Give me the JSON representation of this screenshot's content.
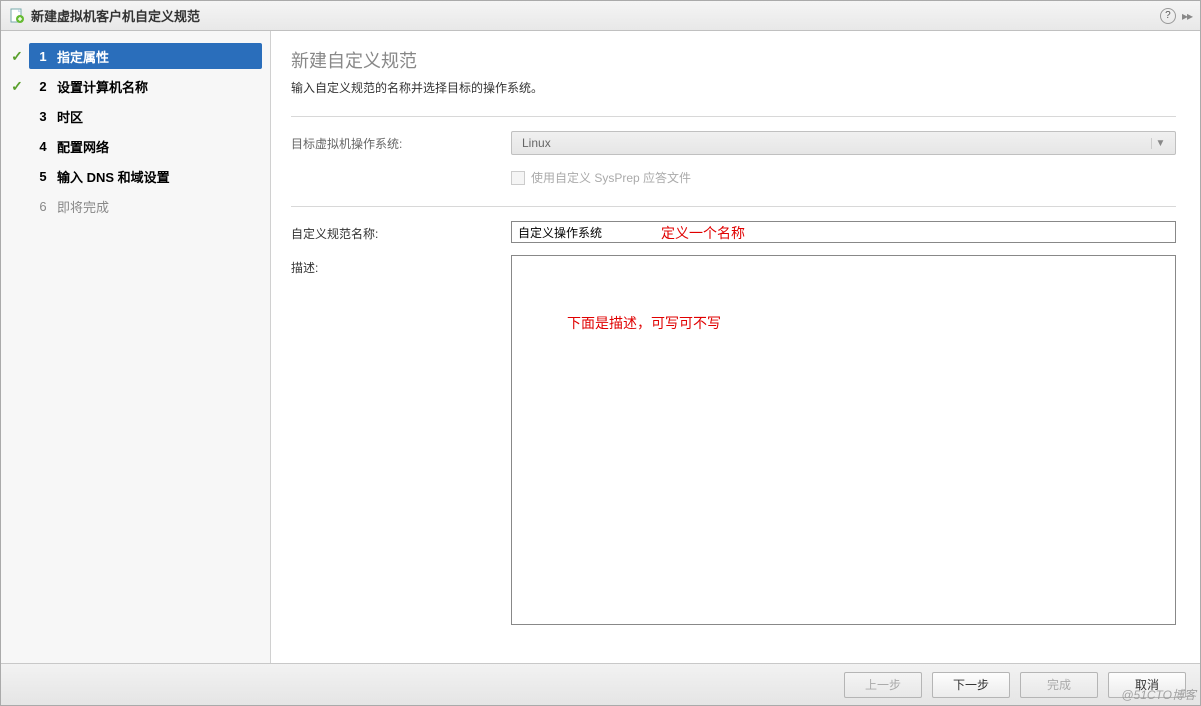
{
  "titlebar": {
    "title": "新建虚拟机客户机自定义规范"
  },
  "sidebar": {
    "steps": [
      {
        "num": "1",
        "label": "指定属性",
        "checked": true,
        "active": true
      },
      {
        "num": "2",
        "label": "设置计算机名称",
        "checked": true,
        "active": false
      },
      {
        "num": "3",
        "label": "时区",
        "checked": false,
        "active": false
      },
      {
        "num": "4",
        "label": "配置网络",
        "checked": false,
        "active": false
      },
      {
        "num": "5",
        "label": "输入 DNS 和域设置",
        "checked": false,
        "active": false
      },
      {
        "num": "6",
        "label": "即将完成",
        "checked": false,
        "active": false,
        "dim": true
      }
    ]
  },
  "main": {
    "title": "新建自定义规范",
    "subtitle": "输入自定义规范的名称并选择目标的操作系统。",
    "os_label": "目标虚拟机操作系统:",
    "os_value": "Linux",
    "sysprep_label": "使用自定义 SysPrep 应答文件",
    "name_label": "自定义规范名称:",
    "name_value": "自定义操作系统",
    "desc_label": "描述:",
    "annotation_name": "定义一个名称",
    "annotation_desc": "下面是描述，可写可不写"
  },
  "footer": {
    "back": "上一步",
    "next": "下一步",
    "finish": "完成",
    "cancel": "取消"
  },
  "watermark": "@51CTO博客"
}
